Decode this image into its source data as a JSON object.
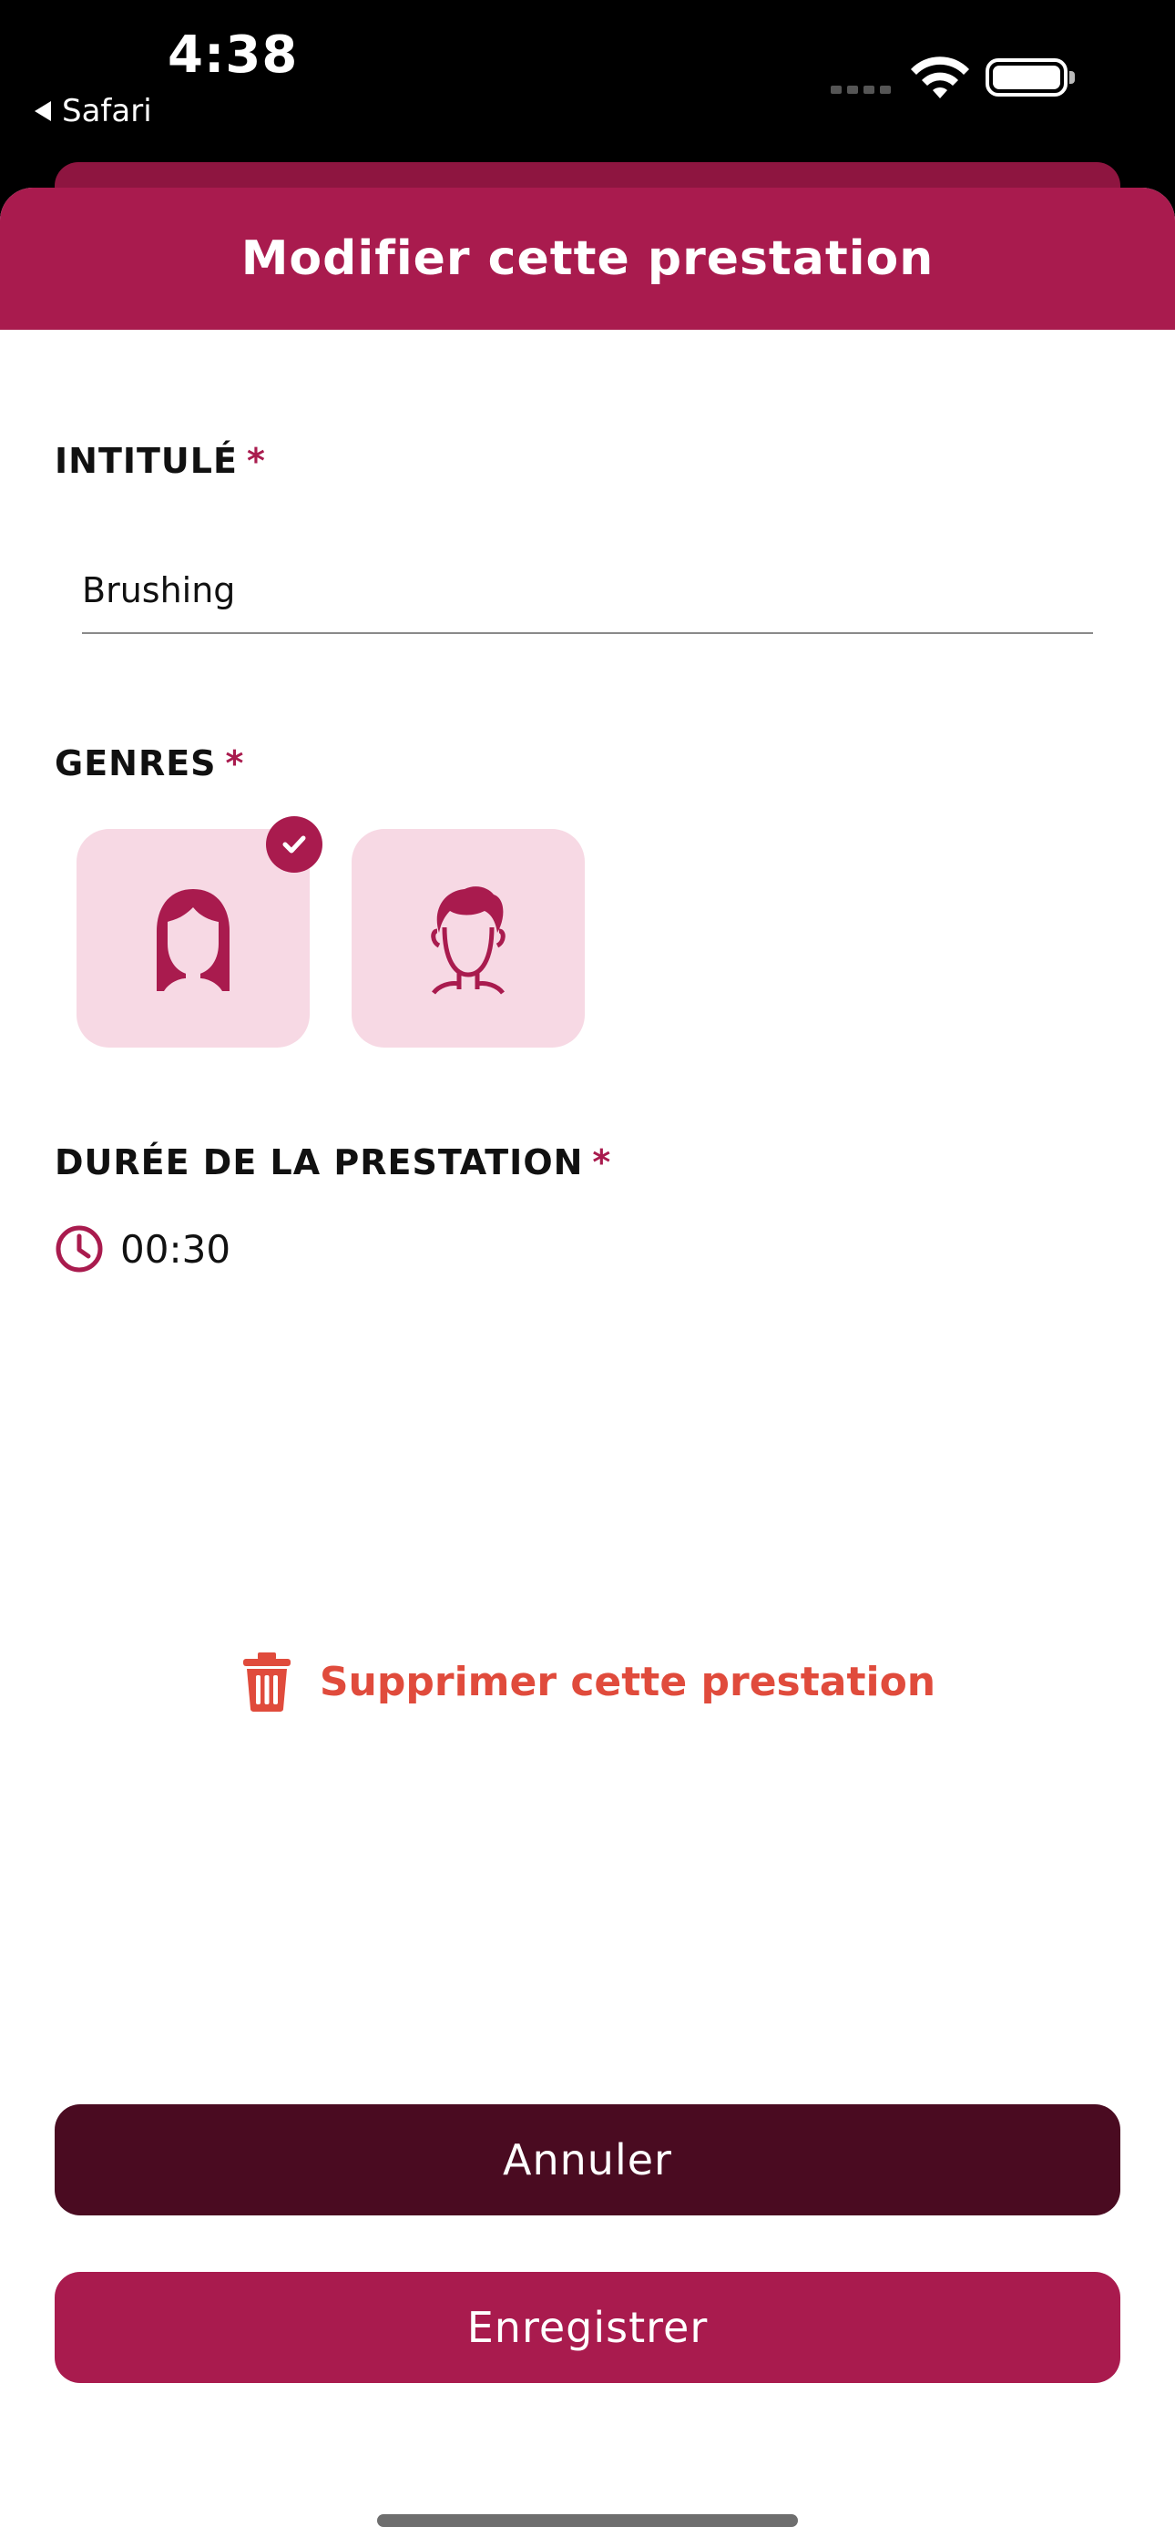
{
  "status_bar": {
    "time": "4:38",
    "back_app": "Safari"
  },
  "sheet": {
    "title": "Modifier cette prestation"
  },
  "form": {
    "title_field": {
      "label": "INTITULÉ",
      "required_mark": "*",
      "value": "Brushing"
    },
    "genres": {
      "label": "GENRES",
      "required_mark": "*",
      "options": [
        {
          "icon": "woman-icon",
          "selected": true
        },
        {
          "icon": "man-icon",
          "selected": false
        }
      ]
    },
    "duration": {
      "label": "DURÉE DE LA PRESTATION",
      "required_mark": "*",
      "value": "00:30",
      "icon": "clock-icon"
    }
  },
  "actions": {
    "delete_label": "Supprimer cette prestation",
    "cancel_label": "Annuler",
    "save_label": "Enregistrer"
  },
  "colors": {
    "brand": "#a91b4e",
    "brand_dark": "#4a0b21",
    "danger": "#e04b3c",
    "tile_bg": "#f7d9e4"
  }
}
